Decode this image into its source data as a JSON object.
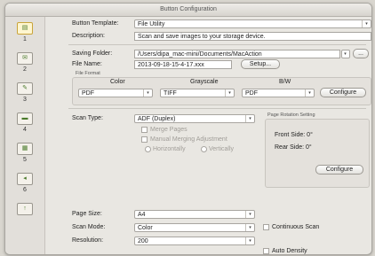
{
  "window": {
    "title": "Button Configuration"
  },
  "sidebar": {
    "items": [
      {
        "num": "1"
      },
      {
        "num": "2"
      },
      {
        "num": "3"
      },
      {
        "num": "4"
      },
      {
        "num": "5"
      },
      {
        "num": "6"
      }
    ]
  },
  "template": {
    "label": "Button Template:",
    "value": "File Utility"
  },
  "description": {
    "label": "Description:",
    "value": "Scan and save images to your storage device."
  },
  "saving": {
    "folder_label": "Saving Folder:",
    "folder_value": "/Users/dipa_mac-mini/Documents/MacAction",
    "browse_label": "...",
    "filename_label": "File Name:",
    "filename_value": "2013-09-18-15-4-17.xxx",
    "setup_label": "Setup..."
  },
  "format": {
    "group_label": "File Format",
    "color_label": "Color",
    "color_value": "PDF",
    "gray_label": "Grayscale",
    "gray_value": "TIFF",
    "bw_label": "B/W",
    "bw_value": "PDF",
    "configure_label": "Configure"
  },
  "scan": {
    "type_label": "Scan Type:",
    "type_value": "ADF (Duplex)",
    "merge_label": "Merge Pages",
    "manual_label": "Manual Merging Adjustment",
    "horizontal_label": "Horizontally",
    "vertical_label": "Vertically",
    "page_size_label": "Page Size:",
    "page_size_value": "A4",
    "mode_label": "Scan Mode:",
    "mode_value": "Color",
    "res_label": "Resolution:",
    "res_value": "200"
  },
  "rotation": {
    "group_label": "Page Rotation Setting",
    "front_label": "Front Side: 0°",
    "rear_label": "Rear Side: 0°",
    "configure_label": "Configure"
  },
  "options": {
    "continuous_label": "Continuous Scan",
    "density_label": "Auto Density"
  }
}
